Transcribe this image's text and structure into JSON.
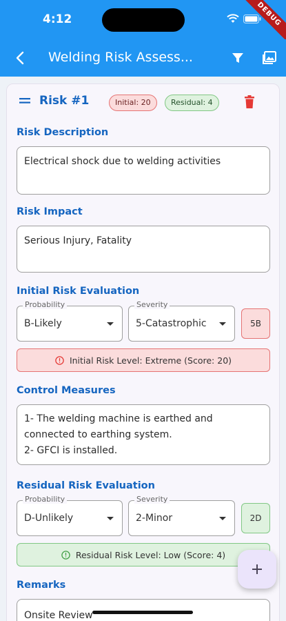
{
  "status_bar": {
    "time": "4:12",
    "debug_label": "DEBUG"
  },
  "app_bar": {
    "title": "Welding Risk Assess..."
  },
  "risk": {
    "title": "Risk #1",
    "initial_badge": "Initial: 20",
    "residual_badge": "Residual: 4",
    "description_label": "Risk Description",
    "description_value": "Electrical shock due to welding activities",
    "impact_label": "Risk Impact",
    "impact_value": "Serious Injury, Fatality",
    "initial_eval_label": "Initial Risk Evaluation",
    "initial_probability_label": "Probability",
    "initial_probability_value": "B-Likely",
    "initial_severity_label": "Severity",
    "initial_severity_value": "5-Catastrophic",
    "initial_code": "5B",
    "initial_level_text": "Initial Risk Level: Extreme (Score: 20)",
    "control_label": "Control Measures",
    "control_line1": "1- The welding machine is earthed and",
    "control_line2": "connected to earthing system.",
    "control_line3": "2- GFCI is installed.",
    "residual_eval_label": "Residual Risk Evaluation",
    "residual_probability_label": "Probability",
    "residual_probability_value": "D-Unlikely",
    "residual_severity_label": "Severity",
    "residual_severity_value": "2-Minor",
    "residual_code": "2D",
    "residual_level_text": "Residual Risk Level: Low (Score: 4)",
    "remarks_label": "Remarks",
    "remarks_value": "Onsite Review"
  },
  "colors": {
    "primary": "#2196f3",
    "label_blue": "#1565c0",
    "danger": "#e53935",
    "success": "#43a047"
  },
  "icons": {
    "back": "back-arrow-icon",
    "filter": "filter-icon",
    "image": "image-icon",
    "drag": "drag-handle-icon",
    "delete": "delete-icon",
    "add": "plus-icon"
  }
}
